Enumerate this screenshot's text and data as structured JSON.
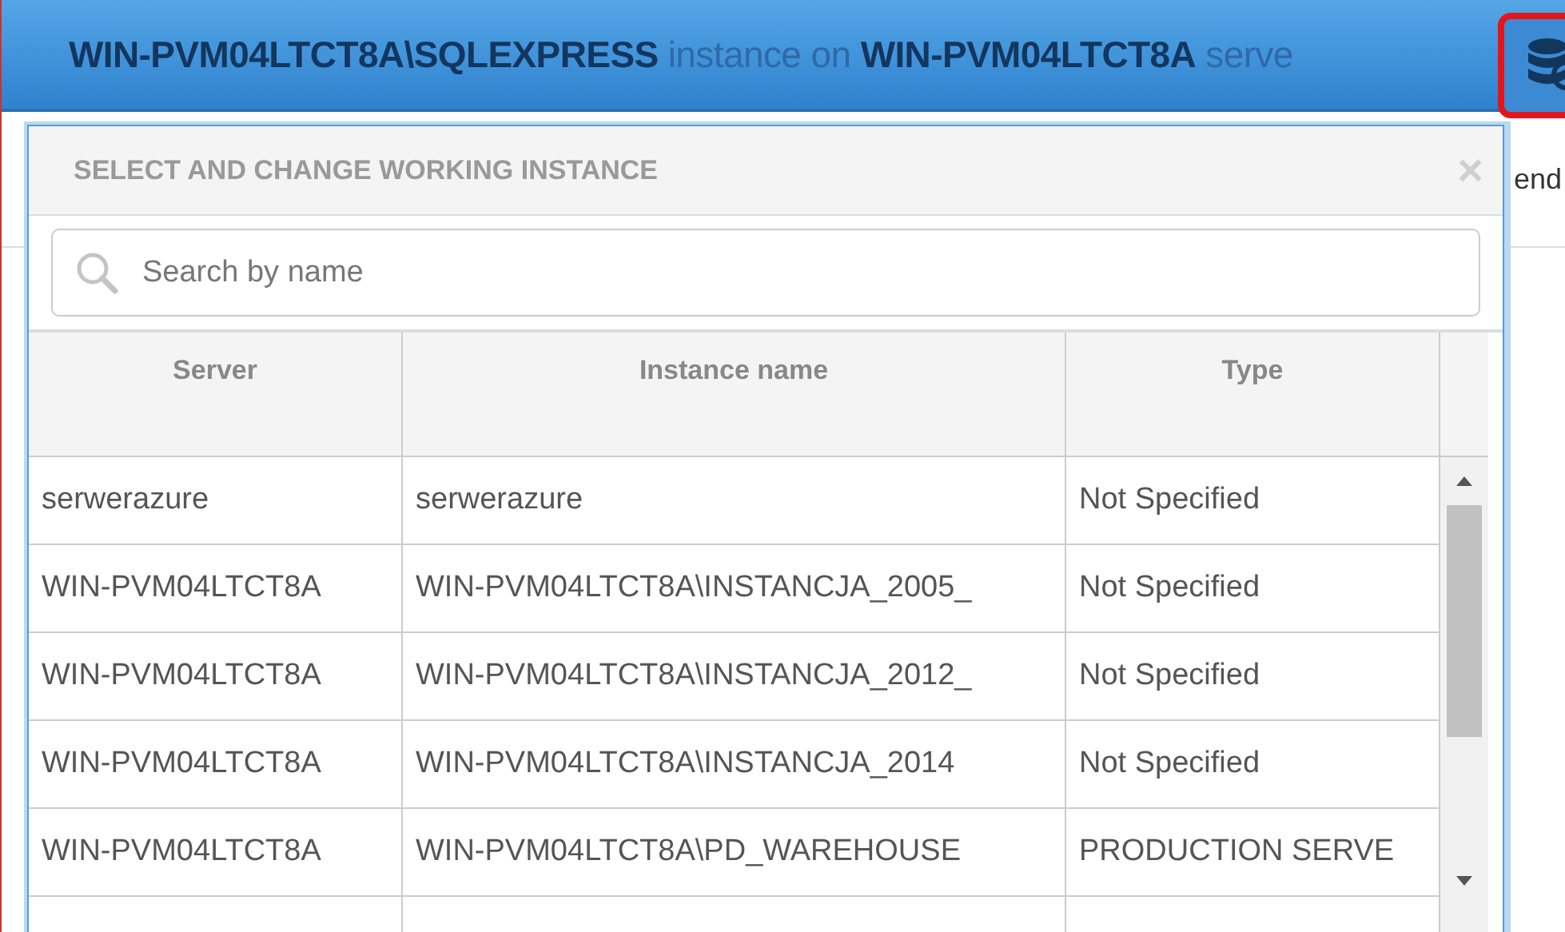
{
  "header": {
    "title": "**WIN-PVM04LTCT8A\\SQLEXPRESS** instance on **WIN-PVM04LTCT8A** serve"
  },
  "background": {
    "label": "end"
  },
  "dialog": {
    "title": "SELECT AND CHANGE WORKING INSTANCE",
    "close": "×",
    "search": {
      "placeholder": "Search by name"
    },
    "table": {
      "columns": [
        "Server",
        "Instance name",
        "Type"
      ],
      "rows": [
        [
          "serwerazure",
          "serwerazure",
          "Not Specified"
        ],
        [
          "WIN-PVM04LTCT8A",
          "WIN-PVM04LTCT8A\\INSTANCJA_2005_",
          "Not Specified"
        ],
        [
          "WIN-PVM04LTCT8A",
          "WIN-PVM04LTCT8A\\INSTANCJA_2012_",
          "Not Specified"
        ],
        [
          "WIN-PVM04LTCT8A",
          "WIN-PVM04LTCT8A\\INSTANCJA_2014",
          "Not Specified"
        ],
        [
          "WIN-PVM04LTCT8A",
          "WIN-PVM04LTCT8A\\PD_WAREHOUSE",
          "PRODUCTION SERVE"
        ]
      ]
    }
  }
}
